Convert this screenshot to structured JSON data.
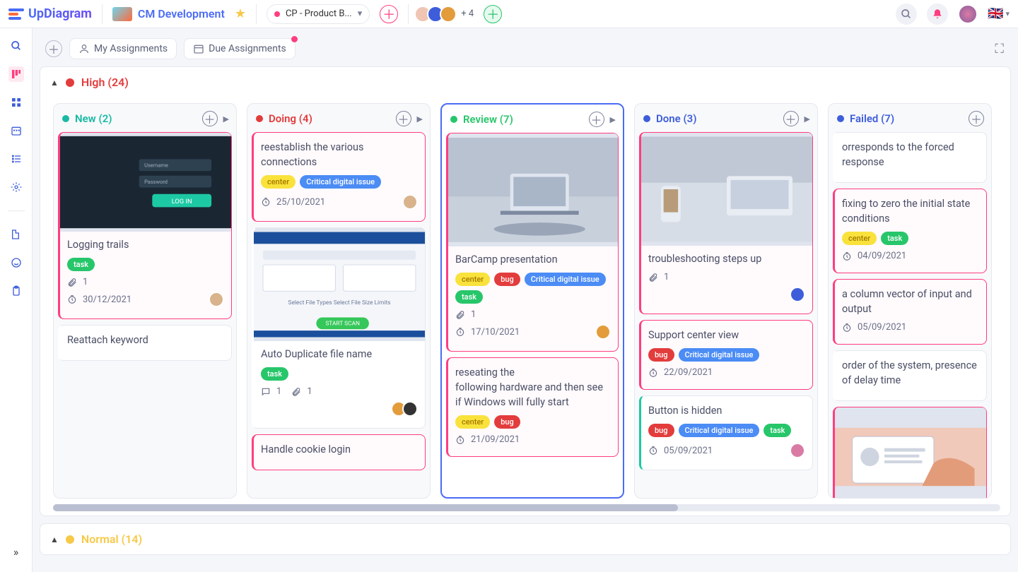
{
  "app": {
    "name": "UpDiagram"
  },
  "project": {
    "name": "CM Development"
  },
  "boardSelect": {
    "label": "CP - Product B...",
    "dot": "#ff3d7f"
  },
  "memberOverflow": "+ 4",
  "toolbar": {
    "myAssignments": "My Assignments",
    "dueAssignments": "Due Assignments"
  },
  "swimlanes": {
    "high": {
      "label": "High",
      "count": "(24)",
      "color": "#e33c3c"
    },
    "normal": {
      "label": "Normal",
      "count": "(14)",
      "color": "#f7c948"
    }
  },
  "columns": [
    {
      "key": "new",
      "label": "New",
      "count": "(2)",
      "dot": "#18b9a4",
      "color": "#18b9a4"
    },
    {
      "key": "doing",
      "label": "Doing",
      "count": "(4)",
      "dot": "#e33c3c",
      "color": "#e33c3c"
    },
    {
      "key": "review",
      "label": "Review",
      "count": "(7)",
      "dot": "#27c66a",
      "color": "#27c66a",
      "selected": true
    },
    {
      "key": "done",
      "label": "Done",
      "count": "(3)",
      "dot": "#3d5ddb",
      "color": "#3d5ddb"
    },
    {
      "key": "failed",
      "label": "Failed",
      "count": "(7)",
      "dot": "#3d5ddb",
      "color": "#3d5ddb",
      "noTri": true
    }
  ],
  "tags": {
    "center": "center",
    "task": "task",
    "bug": "bug",
    "critical": "Critical digital issue"
  },
  "cards": {
    "new": [
      {
        "hasImg": true,
        "imgKind": "login",
        "title": "Logging trails",
        "tags": [
          [
            "task",
            "t-green"
          ]
        ],
        "attach": "1",
        "date": "30/12/2021",
        "avs": [
          "#d9b38c"
        ],
        "cls": "red-b"
      },
      {
        "title": "Reattach keyword",
        "cls": ""
      }
    ],
    "doing": [
      {
        "title": "reestablish the various connections",
        "tags": [
          [
            "center",
            "t-yellow"
          ],
          [
            "critical",
            "t-blue"
          ]
        ],
        "date": "25/10/2021",
        "avs": [
          "#d9b38c"
        ],
        "cls": "red-b"
      },
      {
        "hasImg": true,
        "imgKind": "scan",
        "imgTall": true,
        "title": "Auto Duplicate file name",
        "tags": [
          [
            "task",
            "t-green"
          ]
        ],
        "comments": "1",
        "attach": "1",
        "avs": [
          "#e39c3c",
          "#333"
        ],
        "cls": ""
      },
      {
        "title": "Handle cookie login",
        "cls": "red-b"
      }
    ],
    "review": [
      {
        "hasImg": true,
        "imgKind": "laptop",
        "imgTall": true,
        "title": "BarCamp presentation",
        "tags": [
          [
            "center",
            "t-yellow"
          ],
          [
            "bug",
            "t-red"
          ],
          [
            "critical",
            "t-blue"
          ],
          [
            "task",
            "t-green"
          ]
        ],
        "attach": "1",
        "date": "17/10/2021",
        "avs": [
          "#e39c3c"
        ],
        "cls": "red-b"
      },
      {
        "title": "reseating the\nfollowing hardware and then see if Windows will fully start",
        "tags": [
          [
            "center",
            "t-yellow"
          ],
          [
            "bug",
            "t-red"
          ]
        ],
        "date": "21/09/2021",
        "cls": "red-b"
      }
    ],
    "done": [
      {
        "hasImg": true,
        "imgKind": "coffee",
        "imgTall": true,
        "title": "troubleshooting steps up",
        "attach": "1",
        "avs": [
          "#3d5ddb"
        ],
        "cls": "red-b"
      },
      {
        "title": "Support center view",
        "tags": [
          [
            "bug",
            "t-red"
          ],
          [
            "critical",
            "t-blue"
          ]
        ],
        "date": "22/09/2021",
        "cls": "red-b"
      },
      {
        "title": "Button is hidden",
        "tags": [
          [
            "bug",
            "t-red"
          ],
          [
            "critical",
            "t-blue"
          ],
          [
            "task",
            "t-green"
          ]
        ],
        "date": "05/09/2021",
        "avs": [
          "#d97ba5"
        ],
        "cls": "teal-b"
      }
    ],
    "failed": [
      {
        "title": "orresponds to the forced response",
        "cls": ""
      },
      {
        "title": "fixing to zero the initial  state conditions",
        "tags": [
          [
            "center",
            "t-yellow"
          ],
          [
            "task",
            "t-green"
          ]
        ],
        "date": "04/09/2021",
        "cls": "red-b"
      },
      {
        "title": "a column vector of input and output",
        "date": "05/09/2021",
        "cls": "red-b"
      },
      {
        "title": "order of the system, presence of delay time",
        "cls": ""
      },
      {
        "hasImg": true,
        "imgKind": "id",
        "cls": "red-b"
      }
    ]
  }
}
